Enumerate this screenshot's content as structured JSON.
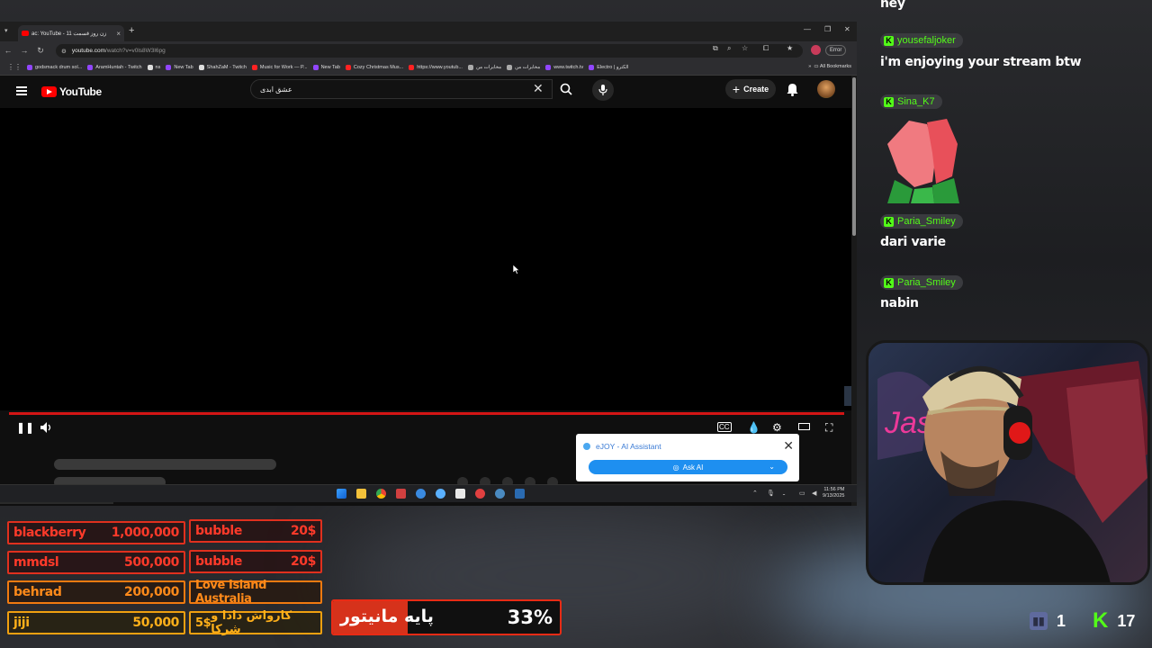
{
  "browser": {
    "tab_title": "ac: YouTube - زن روز قسمت 11",
    "url_host": "youtube.com",
    "url_path": "/watch?v=v0ls8W3l6pg",
    "error_label": "Error",
    "bookmarks": [
      "godsmack drum sol...",
      "AramHuntah - Twitch",
      "ns",
      "New Tab",
      "ShahZaM - Twitch",
      "Music for Work — P...",
      "New Tab",
      "Cozy Christmas Mus...",
      "https://www.youtub...",
      "مخابرات من",
      "مخابرات من",
      "www.twitch.tv",
      "Electro | الکترو"
    ],
    "all_bookmarks": "All Bookmarks",
    "status_url": "https://www.youtube.com/watch?v=v0ls8W3l6pg"
  },
  "youtube": {
    "logo_text": "YouTube",
    "search_value": "عشق ابدی",
    "create_label": "Create"
  },
  "ejoy": {
    "title": "eJOY - AI Assistant",
    "ask_label": "Ask AI"
  },
  "taskbar": {
    "time": "11:56 PM",
    "date": "9/13/2025"
  },
  "chat": {
    "top_msg": "hey",
    "messages": [
      {
        "user": "yousefaljoker",
        "text": "i'm enjoying your stream btw"
      },
      {
        "user": "Sina_K7",
        "text": ""
      },
      {
        "user": "Paria_Smiley",
        "text": "dari varie"
      },
      {
        "user": "Paria_Smiley",
        "text": "nabin"
      }
    ]
  },
  "donations": [
    {
      "name": "blackberry",
      "amount": "1,000,000",
      "color": "#e0301e"
    },
    {
      "name": "mmdsl",
      "amount": "500,000",
      "color": "#e0301e"
    },
    {
      "name": "behrad",
      "amount": "200,000",
      "color": "#f07a10"
    },
    {
      "name": "jiji",
      "amount": "50,000",
      "color": "#f0a010"
    }
  ],
  "donations_right": [
    {
      "name": "bubble",
      "amount": "20$",
      "color": "#e0301e"
    },
    {
      "name": "bubble",
      "amount": "20$",
      "color": "#e0301e"
    },
    {
      "name": "Love Island Australia",
      "amount": "",
      "color": "#f07a10"
    },
    {
      "name": "کارواش دادا و شرکا",
      "amount": "5$",
      "color": "#f0a010"
    }
  ],
  "goal": {
    "label": "پایه مانیتور",
    "percent_text": "33%",
    "percent": 33
  },
  "viewers": {
    "twitch": "1",
    "kick": "17"
  }
}
